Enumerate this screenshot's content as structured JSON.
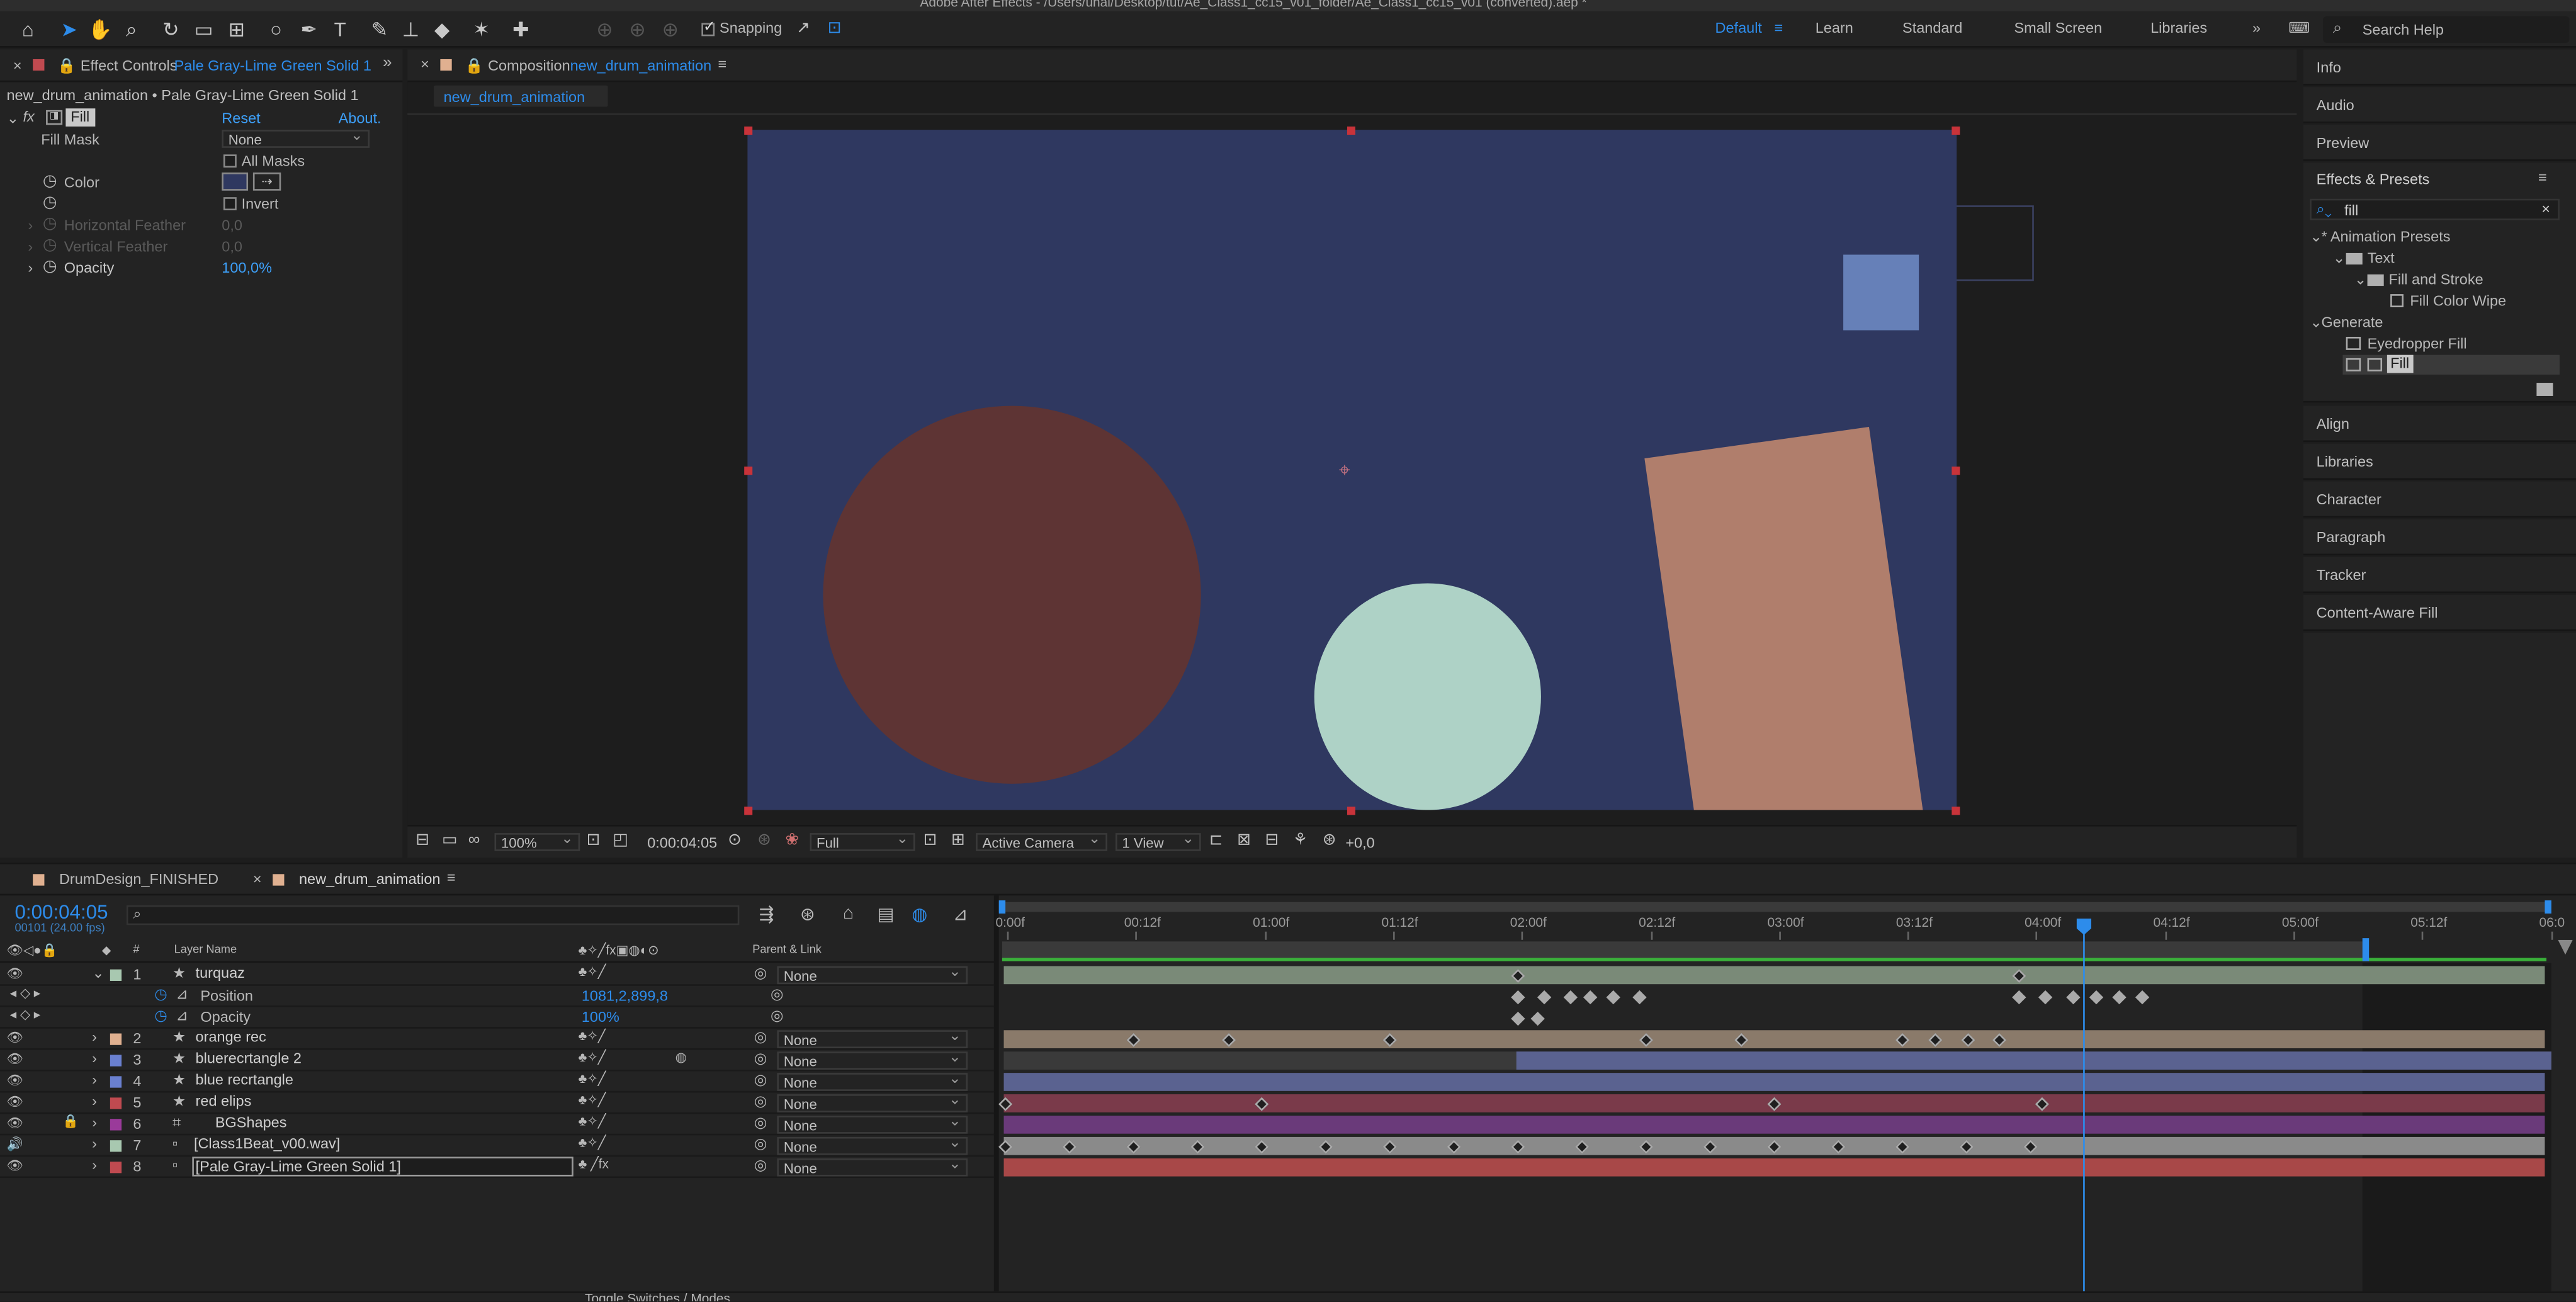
{
  "app": {
    "title": "Adobe After Effects - /Users/unal/Desktop/tut/Ae_Class1_cc15_v01_folder/Ae_Class1_cc15_v01 (converted).aep *"
  },
  "toolbar": {
    "snapping_label": "Snapping",
    "snapping_checked": true,
    "workspaces": [
      "Default",
      "Learn",
      "Standard",
      "Small Screen",
      "Libraries"
    ],
    "active_workspace": "Default",
    "search_placeholder": "Search Help"
  },
  "effect_controls": {
    "tab_prefix": "Effect Controls",
    "tab_layer": "Pale Gray-Lime Green Solid 1",
    "breadcrumb": "new_drum_animation • Pale Gray-Lime Green Solid 1",
    "effect_name": "Fill",
    "reset_label": "Reset",
    "about_label": "About.",
    "fill_mask_label": "Fill Mask",
    "fill_mask_value": "None",
    "all_masks_label": "All Masks",
    "color_label": "Color",
    "invert_label": "Invert",
    "horizontal_feather_label": "Horizontal Feather",
    "horizontal_feather_value": "0,0",
    "vertical_feather_label": "Vertical Feather",
    "vertical_feather_value": "0,0",
    "opacity_label": "Opacity",
    "opacity_value": "100,0%",
    "fill_color": "#2f3860"
  },
  "composition": {
    "tab_prefix": "Composition",
    "tab_name": "new_drum_animation",
    "breadcrumb": "new_drum_animation",
    "background_color": "#2f3860",
    "footer": {
      "zoom": "100%",
      "timecode": "0:00:04:05",
      "resolution": "Full",
      "camera": "Active Camera",
      "views": "1 View",
      "exposure": "+0,0"
    }
  },
  "right_panels": {
    "top": [
      "Info",
      "Audio",
      "Preview"
    ],
    "effects_presets_title": "Effects & Presets",
    "search_value": "fill",
    "tree": [
      {
        "label": "* Animation Presets",
        "level": 0
      },
      {
        "label": "Text",
        "level": 1
      },
      {
        "label": "Fill and Stroke",
        "level": 2
      },
      {
        "label": "Fill Color Wipe",
        "level": 3
      },
      {
        "label": "Generate",
        "level": 0
      },
      {
        "label": "Eyedropper Fill",
        "level": 1
      },
      {
        "label": "Fill",
        "level": 1
      }
    ],
    "bottom": [
      "Align",
      "Libraries",
      "Character",
      "Paragraph",
      "Tracker",
      "Content-Aware Fill"
    ]
  },
  "timeline": {
    "tabs": [
      "DrumDesign_FINISHED",
      "new_drum_animation"
    ],
    "current_time": "0:00:04:05",
    "frame_info": "00101 (24.00 fps)",
    "layer_name_header": "Layer Name",
    "parent_header": "Parent & Link",
    "ruler": [
      "0:00f",
      "00:12f",
      "01:00f",
      "01:12f",
      "02:00f",
      "02:12f",
      "03:00f",
      "03:12f",
      "04:00f",
      "04:12f",
      "05:00f",
      "05:12f",
      "06:0"
    ],
    "layers": [
      {
        "num": "1",
        "name": "turquaz",
        "color": "#a8c8b0",
        "parent": "None",
        "bar": "#7a8a78"
      },
      {
        "num": "2",
        "name": "orange rec",
        "color": "#e0b090",
        "parent": "None",
        "bar": "#8a7a6a"
      },
      {
        "num": "3",
        "name": "bluerecrtangle 2",
        "color": "#6a80d0",
        "parent": "None",
        "bar": "#5a6290"
      },
      {
        "num": "4",
        "name": "blue recrtangle",
        "color": "#6a80d0",
        "parent": "None",
        "bar": "#5a6290"
      },
      {
        "num": "5",
        "name": "red elips",
        "color": "#c04a50",
        "parent": "None",
        "bar": "#7a3a4a"
      },
      {
        "num": "6",
        "name": "BGShapes",
        "color": "#9a3a9a",
        "parent": "None",
        "bar": "#6a3a7a"
      },
      {
        "num": "7",
        "name": "[Class1Beat_v00.wav]",
        "color": "#a8c8b0",
        "parent": "None",
        "bar": "#8a8a8a"
      },
      {
        "num": "8",
        "name": "[Pale Gray-Lime Green Solid 1]",
        "color": "#c04a50",
        "parent": "None",
        "bar": "#a84848"
      }
    ],
    "position_label": "Position",
    "position_value": "1081,2,899,8",
    "opacity_label": "Opacity",
    "opacity_value": "100%",
    "footer": "Toggle Switches / Modes"
  },
  "shapes": {
    "red_circle": "#5e3434",
    "mint_circle": "#aed2c6",
    "orange_rect": "#b07e6c",
    "blue_square": "#6680b8"
  }
}
